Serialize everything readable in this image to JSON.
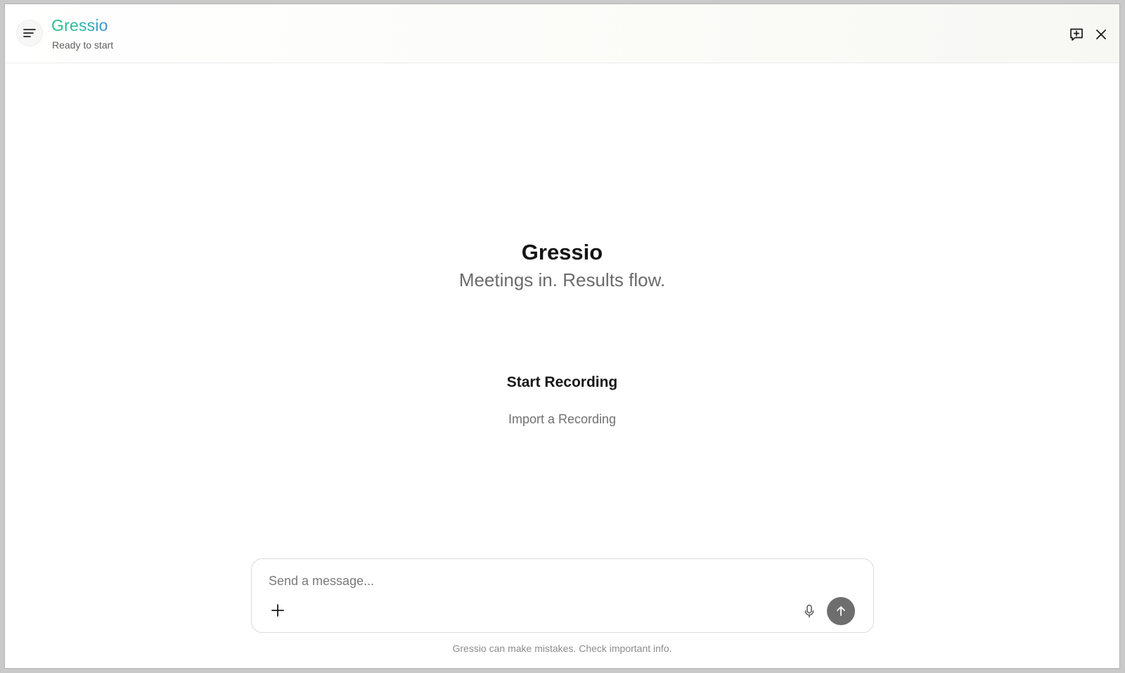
{
  "app": {
    "name": "Gressio",
    "status": "Ready to start"
  },
  "header": {
    "icons": {
      "menu": "menu-icon",
      "new_chat": "new-chat-icon",
      "close": "close-icon"
    }
  },
  "hero": {
    "title": "Gressio",
    "tagline": "Meetings in. Results flow."
  },
  "actions": {
    "start_recording": "Start Recording",
    "import_recording": "Import a Recording"
  },
  "composer": {
    "placeholder": "Send a message...",
    "value": "",
    "icons": {
      "attach": "plus-icon",
      "mic": "microphone-icon",
      "send": "arrow-up-icon"
    }
  },
  "footer": {
    "disclaimer": "Gressio can make mistakes. Check important info."
  },
  "colors": {
    "brand_gradient_start": "#27c281",
    "brand_gradient_end": "#3b8fd9",
    "send_button": "#6e6e6e"
  }
}
